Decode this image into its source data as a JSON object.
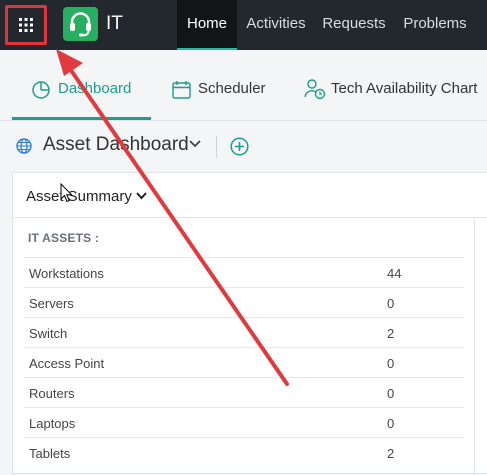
{
  "app": {
    "title": "IT",
    "accent_color": "#27ae60",
    "highlight_color": "#e2343b"
  },
  "topnav": {
    "apps_icon": "grid-icon",
    "tabs": [
      {
        "label": "Home",
        "active": true
      },
      {
        "label": "Activities",
        "active": false
      },
      {
        "label": "Requests",
        "active": false
      },
      {
        "label": "Problems",
        "active": false
      }
    ]
  },
  "subtabs": [
    {
      "label": "Dashboard",
      "icon": "pie-chart-icon",
      "active": true
    },
    {
      "label": "Scheduler",
      "icon": "calendar-icon",
      "active": false
    },
    {
      "label": "Tech Availability Chart",
      "icon": "user-clock-icon",
      "active": false
    }
  ],
  "dashboard": {
    "title": "Asset Dashboard"
  },
  "card": {
    "title": "Asset Summary",
    "section_label": "IT ASSETS :",
    "rows": [
      {
        "name": "Workstations",
        "count": "44"
      },
      {
        "name": "Servers",
        "count": "0"
      },
      {
        "name": "Switch",
        "count": "2"
      },
      {
        "name": "Access Point",
        "count": "0"
      },
      {
        "name": "Routers",
        "count": "0"
      },
      {
        "name": "Laptops",
        "count": "0"
      },
      {
        "name": "Tablets",
        "count": "2"
      }
    ]
  }
}
